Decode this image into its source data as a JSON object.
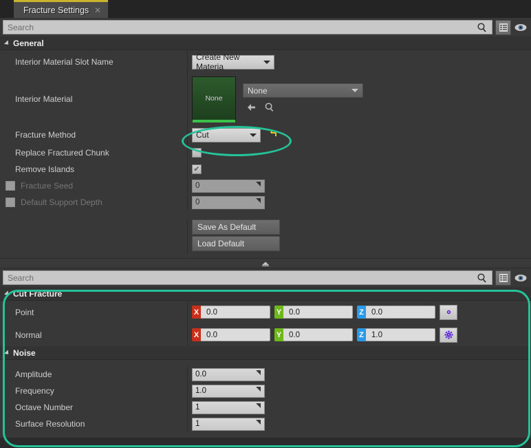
{
  "tab": {
    "title": "Fracture Settings",
    "close_icon": "close-icon"
  },
  "toolbar_top": {
    "search_placeholder": "Search",
    "search_icon": "search-icon",
    "settings_icon": "grid-settings-icon",
    "visibility_icon": "eye-icon"
  },
  "toolbar_bottom": {
    "search_placeholder": "Search",
    "search_icon": "search-icon",
    "settings_icon": "grid-settings-icon",
    "visibility_icon": "eye-icon"
  },
  "general": {
    "title": "General",
    "interior_material_slot_name": {
      "label": "Interior Material Slot Name",
      "value": "Create New Materia"
    },
    "interior_material": {
      "label": "Interior Material",
      "thumbnail_text": "None",
      "asset_value": "None",
      "browse_icon": "back-arrow-icon",
      "find_icon": "search-icon"
    },
    "fracture_method": {
      "label": "Fracture Method",
      "value": "Cut",
      "reset_icon": "reset-arrow-icon"
    },
    "replace_fractured_chunk": {
      "label": "Replace Fractured Chunk",
      "checked": false
    },
    "remove_islands": {
      "label": "Remove Islands",
      "checked": true,
      "check_glyph": "✔"
    },
    "fracture_seed": {
      "label": "Fracture Seed",
      "value": "0",
      "enabled": false
    },
    "default_support_depth": {
      "label": "Default Support Depth",
      "value": "0",
      "enabled": false
    },
    "save_as_default_label": "Save As Default",
    "load_default_label": "Load Default"
  },
  "splitter": {
    "handle_icon": "collapse-up-icon"
  },
  "cut_fracture": {
    "title": "Cut Fracture",
    "point": {
      "label": "Point",
      "x_axis": "X",
      "x": "0.0",
      "y_axis": "Y",
      "y": "0.0",
      "z_axis": "Z",
      "z": "0.0",
      "options_icon": "gear-icon"
    },
    "normal": {
      "label": "Normal",
      "x_axis": "X",
      "x": "0.0",
      "y_axis": "Y",
      "y": "0.0",
      "z_axis": "Z",
      "z": "1.0",
      "options_icon": "gear-icon"
    }
  },
  "noise": {
    "title": "Noise",
    "amplitude": {
      "label": "Amplitude",
      "value": "0.0"
    },
    "frequency": {
      "label": "Frequency",
      "value": "1.0"
    },
    "octave_number": {
      "label": "Octave Number",
      "value": "1"
    },
    "surface_resolution": {
      "label": "Surface Resolution",
      "value": "1"
    }
  },
  "colors": {
    "highlight": "#25c39a",
    "tab_accent": "#c9b42b",
    "axis_x": "#c8301b",
    "axis_y": "#6fb81c",
    "axis_z": "#2b9ae8",
    "gear": "#5b1fe0",
    "thumbnail_accent": "#3dc04a"
  }
}
